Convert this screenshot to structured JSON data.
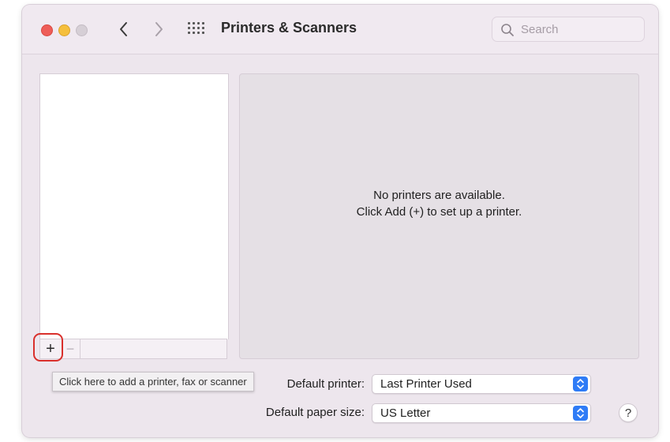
{
  "window": {
    "title": "Printers & Scanners"
  },
  "search": {
    "placeholder": "Search",
    "value": ""
  },
  "printer_list": {
    "items": [],
    "add_label": "+",
    "remove_label": "−"
  },
  "detail": {
    "empty_line1": "No printers are available.",
    "empty_line2": "Click Add (+) to set up a printer."
  },
  "tooltip": {
    "text": "Click here to add a printer, fax or scanner"
  },
  "defaults": {
    "printer_label": "Default printer:",
    "printer_value": "Last Printer Used",
    "paper_label": "Default paper size:",
    "paper_value": "US Letter"
  },
  "help": {
    "label": "?"
  },
  "colors": {
    "accent": "#2f7cf6",
    "highlight": "#d9302c",
    "close": "#ee5d58",
    "minimize": "#f5bf3c"
  },
  "icons": {
    "back": "chevron-left-icon",
    "forward": "chevron-right-icon",
    "show_all": "grid-icon",
    "search": "magnifier-icon",
    "popup": "up-down-chevron-icon"
  }
}
